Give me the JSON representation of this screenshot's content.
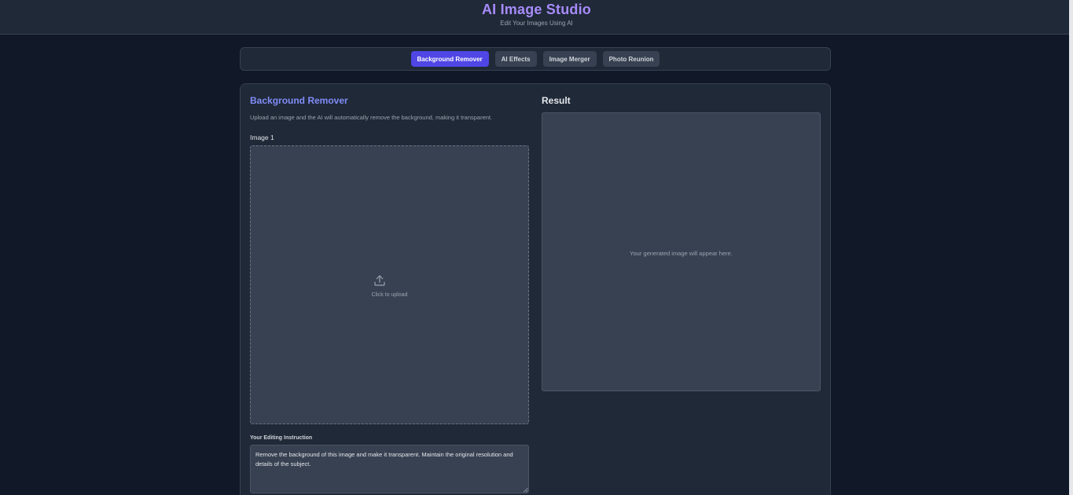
{
  "header": {
    "title": "AI Image Studio",
    "subtitle": "Edit Your Images Using AI"
  },
  "tabs": [
    {
      "label": "Background Remover",
      "active": true
    },
    {
      "label": "AI Effects",
      "active": false
    },
    {
      "label": "Image Merger",
      "active": false
    },
    {
      "label": "Photo Reunion",
      "active": false
    }
  ],
  "tool": {
    "title": "Background Remover",
    "description": "Upload an image and the AI will automatically remove the background, making it transparent.",
    "image_label": "Image 1",
    "upload_text": "Click to upload",
    "upload_icon": "upload-icon",
    "instruction_label": "Your Editing Instruction",
    "instruction_value": "Remove the background of this image and make it transparent. Maintain the original resolution and details of the subject."
  },
  "result": {
    "title": "Result",
    "placeholder": "Your generated image will appear here."
  },
  "colors": {
    "background": "#111827",
    "panel": "#1f2937",
    "accent": "#4f46e5",
    "title": "#a78bfa"
  }
}
